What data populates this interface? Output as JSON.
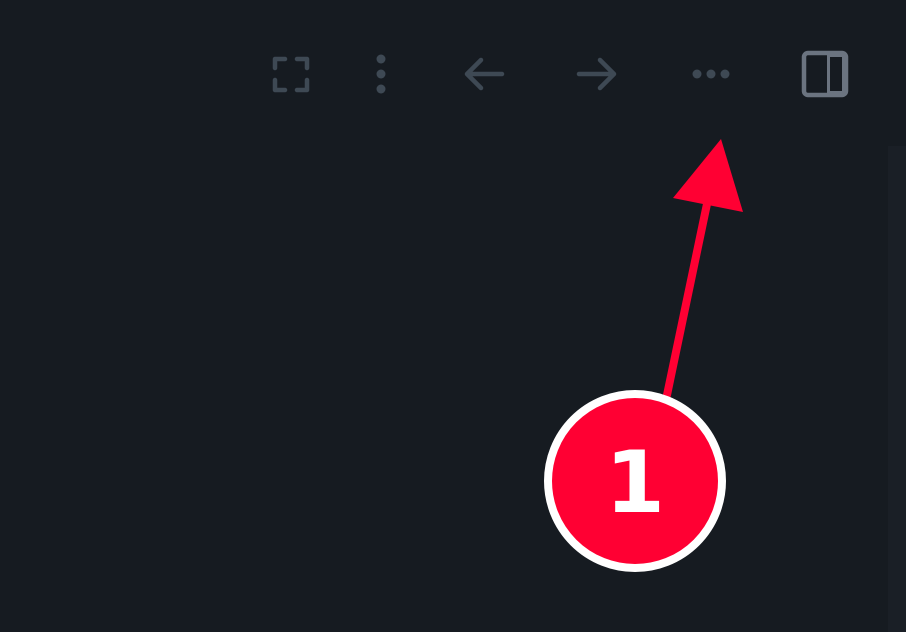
{
  "toolbar": {
    "icons": [
      "fullscreen-icon",
      "vertical-more-icon",
      "arrow-left-icon",
      "arrow-right-icon",
      "horizontal-more-icon",
      "sidebar-panel-icon"
    ],
    "icon_color": "#3e4954",
    "panel_icon_color": "#6b7480"
  },
  "annotation": {
    "step_number": "1",
    "badge_color": "#ff0033",
    "badge_border_color": "#ffffff",
    "arrow_color": "#ff0033"
  },
  "theme": {
    "background": "#161b21"
  }
}
